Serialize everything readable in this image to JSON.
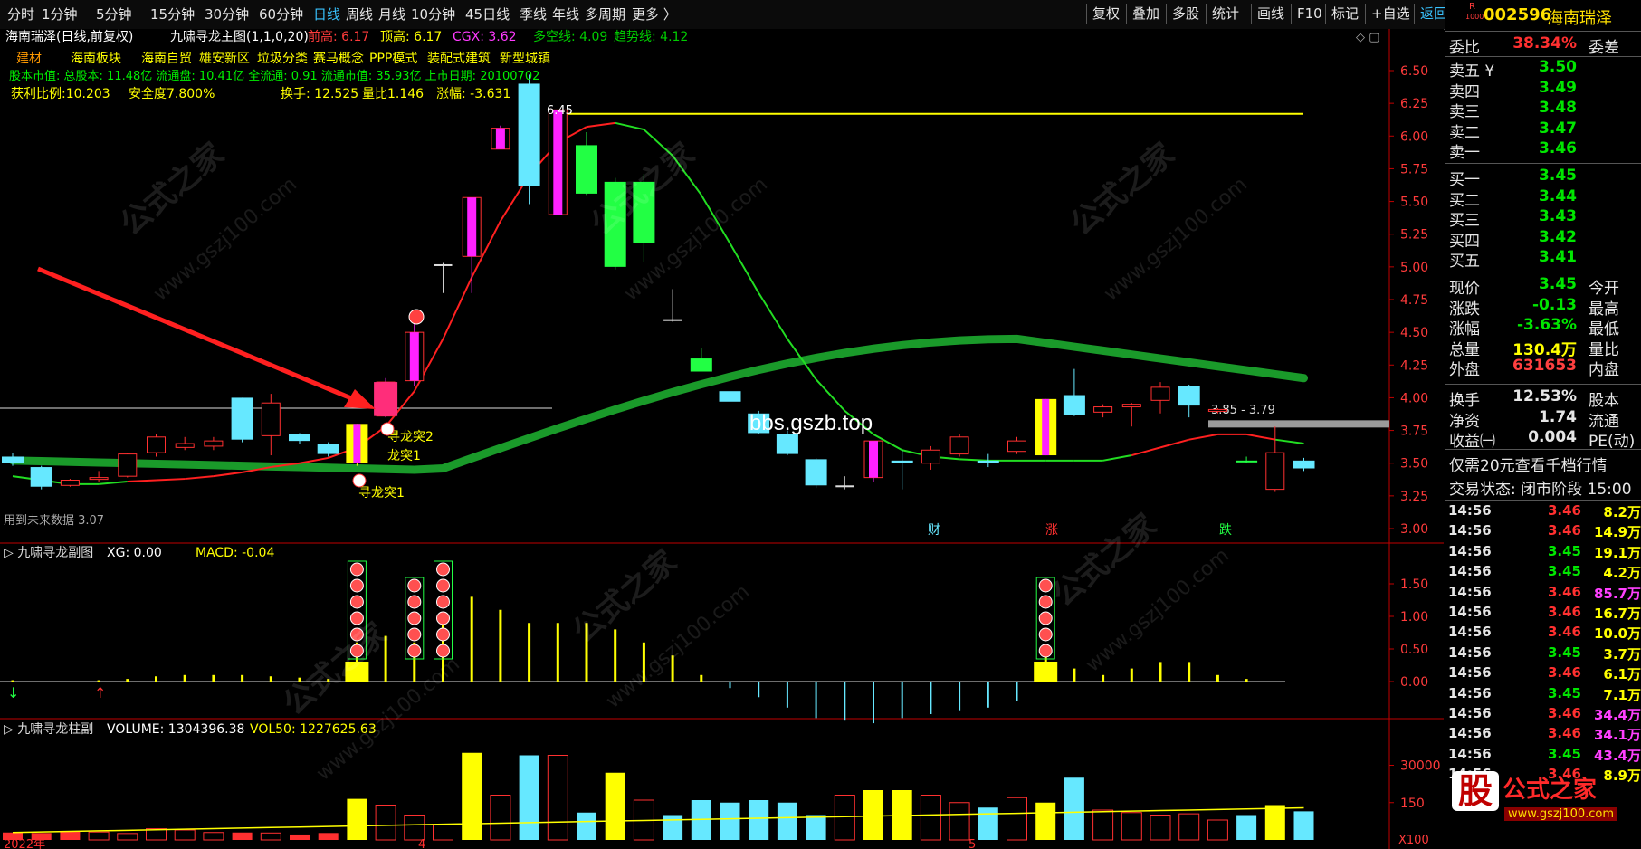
{
  "toolbar": {
    "periods": [
      "分时",
      "1分钟",
      "5分钟",
      "15分钟",
      "30分钟",
      "60分钟",
      "日线",
      "周线",
      "月线",
      "10分钟",
      "45日线",
      "季线",
      "年线",
      "多周期",
      "更多 〉"
    ],
    "active": "日线",
    "right": [
      "复权",
      "叠加",
      "多股",
      "统计",
      "画线",
      "F10",
      "标记",
      "+自选",
      "返回"
    ]
  },
  "main_panel": {
    "stock_title": "海南瑞泽(日线,前复权)",
    "formula": "九啸寻龙主图(1,1,0,20)",
    "indicators": [
      {
        "label": "前高: 6.17",
        "color": "#ff3b3b"
      },
      {
        "label": "顶高: 6.17",
        "color": "#ffff00"
      },
      {
        "label": "CGX: 3.62",
        "color": "#ff3bff"
      },
      {
        "label": "多空线: 4.09",
        "color": "#00cc00"
      },
      {
        "label": "趋势线: 4.12",
        "color": "#00cc00"
      }
    ],
    "info_line1": [
      "建材",
      "海南板块",
      "海南自贸",
      "雄安新区",
      "垃圾分类",
      "赛马概念",
      "PPP模式",
      "装配式建筑",
      "新型城镇"
    ],
    "info_line2": "股本市值: 总股本: 11.48亿 流通盘: 10.41亿 全流通: 0.91 流通市值: 35.93亿 上市日期: 20100702",
    "info_line3": [
      "获利比例:10.203",
      "安全度7.800%",
      "换手: 12.525",
      "量比1.146",
      "涨幅: -3.631"
    ],
    "footer_note": "用到未来数据 3.07",
    "price_axis": [
      "6.50",
      "6.25",
      "6.00",
      "5.75",
      "5.50",
      "5.25",
      "5.00",
      "4.75",
      "4.50",
      "4.25",
      "4.00",
      "3.75",
      "3.50",
      "3.25",
      "3.00"
    ],
    "peak_label": "6.45",
    "level_label": "3.85 - 3.79",
    "signals": [
      "寻龙突2",
      "龙突1",
      "寻龙突1"
    ],
    "news_markers": [
      "财",
      "涨",
      "跌"
    ],
    "watermark": "bbs.gszb.top"
  },
  "sub_panel1": {
    "title": "九啸寻龙副图",
    "xg": "XG: 0.00",
    "macd": "MACD: -0.04",
    "axis": [
      "1.50",
      "1.00",
      "0.50",
      "0.00"
    ]
  },
  "sub_panel2": {
    "title": "九啸寻龙柱副",
    "volume": "VOLUME: 1304396.38",
    "vol50": "VOL50: 1227625.63",
    "axis": [
      "30000",
      "150"
    ],
    "axis_unit": "X100",
    "date_labels": [
      "2022年",
      "4",
      "5"
    ]
  },
  "quote": {
    "code": "002596",
    "name": "海南瑞泽",
    "badge_r": "R",
    "badge_num": "1000",
    "webi": {
      "label": "委比",
      "value": "38.34%",
      "aux": "委差"
    },
    "sell": [
      {
        "label": "卖五 ¥",
        "price": "3.50"
      },
      {
        "label": "卖四",
        "price": "3.49"
      },
      {
        "label": "卖三",
        "price": "3.48"
      },
      {
        "label": "卖二",
        "price": "3.47"
      },
      {
        "label": "卖一",
        "price": "3.46"
      }
    ],
    "buy": [
      {
        "label": "买一",
        "price": "3.45"
      },
      {
        "label": "买二",
        "price": "3.44"
      },
      {
        "label": "买三",
        "price": "3.43"
      },
      {
        "label": "买四",
        "price": "3.42"
      },
      {
        "label": "买五",
        "price": "3.41"
      }
    ],
    "stats": [
      {
        "label": "现价",
        "value": "3.45",
        "aux": "今开",
        "color": "#00e600"
      },
      {
        "label": "涨跌",
        "value": "-0.13",
        "aux": "最高",
        "color": "#00e600"
      },
      {
        "label": "涨幅",
        "value": "-3.63%",
        "aux": "最低",
        "color": "#00e600"
      },
      {
        "label": "总量",
        "value": "130.4万",
        "aux": "量比",
        "color": "#ffff00"
      },
      {
        "label": "外盘",
        "value": "631653",
        "aux": "内盘",
        "color": "#ff4040"
      }
    ],
    "stats2": [
      {
        "label": "换手",
        "value": "12.53%",
        "aux": "股本"
      },
      {
        "label": "净资",
        "value": "1.74",
        "aux": "流通"
      },
      {
        "label": "收益㈠",
        "value": "0.004",
        "aux": "PE(动)"
      }
    ],
    "promo": "仅需20元查看千档行情",
    "status": "交易状态: 闭市阶段 15:00",
    "ticks": [
      {
        "time": "14:56",
        "price": "3.46",
        "vol": "8.2万"
      },
      {
        "time": "14:56",
        "price": "3.46",
        "vol": "14.9万"
      },
      {
        "time": "14:56",
        "price": "3.45",
        "vol": "19.1万"
      },
      {
        "time": "14:56",
        "price": "3.45",
        "vol": "4.2万"
      },
      {
        "time": "14:56",
        "price": "3.46",
        "vol": "85.7万"
      },
      {
        "time": "14:56",
        "price": "3.46",
        "vol": "16.7万"
      },
      {
        "time": "14:56",
        "price": "3.46",
        "vol": "10.0万"
      },
      {
        "time": "14:56",
        "price": "3.45",
        "vol": "3.7万"
      },
      {
        "time": "14:56",
        "price": "3.46",
        "vol": "6.1万"
      },
      {
        "time": "14:56",
        "price": "3.45",
        "vol": "7.1万"
      },
      {
        "time": "14:56",
        "price": "3.46",
        "vol": "34.4万"
      },
      {
        "time": "14:56",
        "price": "3.46",
        "vol": "34.1万"
      },
      {
        "time": "14:56",
        "price": "3.45",
        "vol": "43.4万"
      },
      {
        "time": "14:56",
        "price": "3.46",
        "vol": "8.9万"
      }
    ]
  },
  "brand": {
    "logo_char": "股",
    "text": "公式之家",
    "url": "www.gszj100.com"
  },
  "watermarks": [
    "公式之家",
    "www.gszj100.com"
  ],
  "candles": [
    {
      "o": 3.55,
      "c": 3.5,
      "h": 3.58,
      "l": 3.48,
      "t": "c"
    },
    {
      "o": 3.47,
      "c": 3.32,
      "h": 3.48,
      "l": 3.3,
      "t": "c"
    },
    {
      "o": 3.33,
      "c": 3.37,
      "h": 3.38,
      "l": 3.32,
      "t": "r"
    },
    {
      "o": 3.38,
      "c": 3.39,
      "h": 3.44,
      "l": 3.36,
      "t": "r"
    },
    {
      "o": 3.4,
      "c": 3.57,
      "h": 3.58,
      "l": 3.39,
      "t": "r"
    },
    {
      "o": 3.58,
      "c": 3.7,
      "h": 3.72,
      "l": 3.55,
      "t": "r"
    },
    {
      "o": 3.62,
      "c": 3.65,
      "h": 3.7,
      "l": 3.6,
      "t": "r"
    },
    {
      "o": 3.63,
      "c": 3.67,
      "h": 3.7,
      "l": 3.6,
      "t": "r"
    },
    {
      "o": 4.0,
      "c": 3.68,
      "h": 4.0,
      "l": 3.66,
      "t": "c"
    },
    {
      "o": 3.71,
      "c": 3.96,
      "h": 4.03,
      "l": 3.56,
      "t": "r"
    },
    {
      "o": 3.72,
      "c": 3.67,
      "h": 3.73,
      "l": 3.65,
      "t": "c"
    },
    {
      "o": 3.65,
      "c": 3.57,
      "h": 3.66,
      "l": 3.55,
      "t": "c"
    },
    {
      "o": 3.5,
      "c": 3.8,
      "h": 3.8,
      "l": 3.48,
      "t": "y"
    },
    {
      "o": 3.86,
      "c": 4.12,
      "h": 4.15,
      "l": 3.85,
      "t": "m"
    },
    {
      "o": 4.13,
      "c": 4.5,
      "h": 4.62,
      "l": 4.09,
      "t": "m"
    },
    {
      "o": 5.02,
      "c": 5.02,
      "h": 5.03,
      "l": 4.8,
      "t": "w"
    },
    {
      "o": 5.08,
      "c": 5.53,
      "h": 5.53,
      "l": 4.8,
      "t": "m"
    },
    {
      "o": 5.9,
      "c": 6.06,
      "h": 6.08,
      "l": 5.91,
      "t": "m"
    },
    {
      "o": 6.4,
      "c": 5.62,
      "h": 6.47,
      "l": 5.48,
      "t": "c"
    },
    {
      "o": 5.4,
      "c": 6.2,
      "h": 6.2,
      "l": 5.4,
      "t": "m"
    },
    {
      "o": 5.93,
      "c": 5.56,
      "h": 6.03,
      "l": 5.55,
      "t": "g"
    },
    {
      "o": 5.65,
      "c": 5.0,
      "h": 5.68,
      "l": 4.98,
      "t": "g"
    },
    {
      "o": 5.18,
      "c": 5.65,
      "h": 5.71,
      "l": 5.04,
      "t": "g"
    },
    {
      "o": 4.6,
      "c": 4.6,
      "h": 4.83,
      "l": 4.58,
      "t": "w"
    },
    {
      "o": 4.2,
      "c": 4.3,
      "h": 4.38,
      "l": 4.2,
      "t": "g"
    },
    {
      "o": 4.05,
      "c": 3.97,
      "h": 4.22,
      "l": 3.95,
      "t": "c"
    },
    {
      "o": 3.88,
      "c": 3.73,
      "h": 3.9,
      "l": 3.72,
      "t": "c"
    },
    {
      "o": 3.72,
      "c": 3.57,
      "h": 3.75,
      "l": 3.56,
      "t": "c"
    },
    {
      "o": 3.53,
      "c": 3.33,
      "h": 3.54,
      "l": 3.31,
      "t": "c"
    },
    {
      "o": 3.32,
      "c": 3.33,
      "h": 3.4,
      "l": 3.3,
      "t": "w"
    },
    {
      "o": 3.39,
      "c": 3.67,
      "h": 3.67,
      "l": 3.36,
      "t": "m"
    },
    {
      "o": 3.5,
      "c": 3.52,
      "h": 3.6,
      "l": 3.3,
      "t": "c"
    },
    {
      "o": 3.5,
      "c": 3.6,
      "h": 3.63,
      "l": 3.45,
      "t": "r"
    },
    {
      "o": 3.57,
      "c": 3.7,
      "h": 3.72,
      "l": 3.55,
      "t": "r"
    },
    {
      "o": 3.5,
      "c": 3.52,
      "h": 3.57,
      "l": 3.47,
      "t": "c"
    },
    {
      "o": 3.59,
      "c": 3.67,
      "h": 3.7,
      "l": 3.57,
      "t": "r"
    },
    {
      "o": 3.56,
      "c": 3.99,
      "h": 3.99,
      "l": 3.56,
      "t": "y"
    },
    {
      "o": 4.02,
      "c": 3.87,
      "h": 4.22,
      "l": 3.86,
      "t": "c"
    },
    {
      "o": 3.89,
      "c": 3.93,
      "h": 3.95,
      "l": 3.85,
      "t": "r"
    },
    {
      "o": 3.93,
      "c": 3.95,
      "h": 3.96,
      "l": 3.78,
      "t": "r"
    },
    {
      "o": 3.98,
      "c": 4.08,
      "h": 4.12,
      "l": 3.88,
      "t": "r"
    },
    {
      "o": 4.09,
      "c": 3.94,
      "h": 4.1,
      "l": 3.85,
      "t": "c"
    },
    {
      "o": 3.9,
      "c": 3.91,
      "h": 3.92,
      "l": 3.88,
      "t": "r"
    },
    {
      "o": 3.52,
      "c": 3.52,
      "h": 3.55,
      "l": 3.5,
      "t": "g"
    },
    {
      "o": 3.58,
      "c": 3.3,
      "h": 3.78,
      "l": 3.28,
      "t": "r"
    },
    {
      "o": 3.52,
      "c": 3.46,
      "h": 3.54,
      "l": 3.44,
      "t": "c"
    }
  ],
  "volumes": [
    {
      "v": 3000,
      "t": "f"
    },
    {
      "v": 2800,
      "t": "f"
    },
    {
      "v": 3600,
      "t": "f"
    },
    {
      "v": 3200,
      "t": "o"
    },
    {
      "v": 2600,
      "t": "o"
    },
    {
      "v": 4500,
      "t": "o"
    },
    {
      "v": 4000,
      "t": "o"
    },
    {
      "v": 3000,
      "t": "o"
    },
    {
      "v": 3000,
      "t": "f"
    },
    {
      "v": 2800,
      "t": "o"
    },
    {
      "v": 2200,
      "t": "f"
    },
    {
      "v": 2800,
      "t": "f"
    },
    {
      "v": 16500,
      "t": "y"
    },
    {
      "v": 14000,
      "t": "o"
    },
    {
      "v": 10000,
      "t": "o"
    },
    {
      "v": 6000,
      "t": "o"
    },
    {
      "v": 35000,
      "t": "y"
    },
    {
      "v": 18000,
      "t": "o"
    },
    {
      "v": 34000,
      "t": "c"
    },
    {
      "v": 34000,
      "t": "o"
    },
    {
      "v": 11000,
      "t": "c"
    },
    {
      "v": 27000,
      "t": "y"
    },
    {
      "v": 16000,
      "t": "o"
    },
    {
      "v": 10000,
      "t": "c"
    },
    {
      "v": 16000,
      "t": "c"
    },
    {
      "v": 15000,
      "t": "c"
    },
    {
      "v": 16000,
      "t": "c"
    },
    {
      "v": 15000,
      "t": "c"
    },
    {
      "v": 10000,
      "t": "c"
    },
    {
      "v": 18000,
      "t": "o"
    },
    {
      "v": 20000,
      "t": "y"
    },
    {
      "v": 20000,
      "t": "y"
    },
    {
      "v": 18000,
      "t": "o"
    },
    {
      "v": 15000,
      "t": "o"
    },
    {
      "v": 13000,
      "t": "c"
    },
    {
      "v": 17000,
      "t": "o"
    },
    {
      "v": 15000,
      "t": "y"
    },
    {
      "v": 25000,
      "t": "c"
    },
    {
      "v": 12000,
      "t": "o"
    },
    {
      "v": 11000,
      "t": "o"
    },
    {
      "v": 10000,
      "t": "o"
    },
    {
      "v": 10500,
      "t": "o"
    },
    {
      "v": 8000,
      "t": "o"
    },
    {
      "v": 10000,
      "t": "c"
    },
    {
      "v": 14000,
      "t": "y"
    },
    {
      "v": 11500,
      "t": "c"
    }
  ],
  "macd_bars": [
    0.01,
    0.0,
    0.0,
    0.01,
    0.02,
    0.04,
    0.05,
    0.05,
    0.05,
    0.04,
    0.03,
    0.02,
    0.3,
    0.35,
    0.3,
    0.5,
    0.65,
    0.55,
    0.45,
    0.45,
    0.45,
    0.4,
    0.3,
    0.2,
    0.05,
    -0.05,
    -0.12,
    -0.2,
    -0.28,
    -0.3,
    -0.32,
    -0.28,
    -0.25,
    -0.22,
    -0.2,
    -0.15,
    0.28,
    0.1,
    0.05,
    0.1,
    0.15,
    0.15,
    0.05,
    0.02,
    0.0,
    0.0
  ]
}
